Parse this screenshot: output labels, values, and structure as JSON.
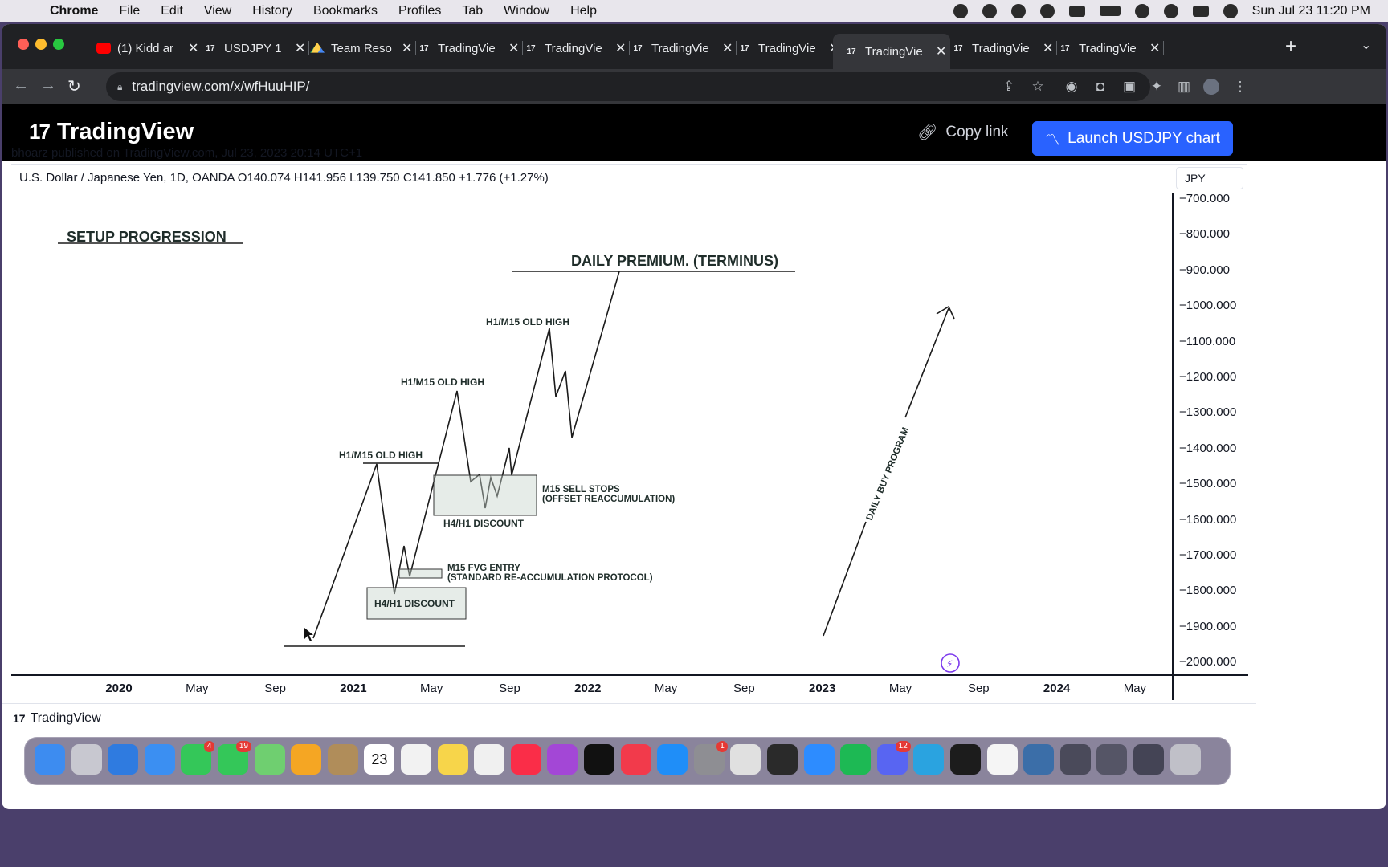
{
  "menubar": {
    "app": "Chrome",
    "items": [
      "File",
      "Edit",
      "View",
      "History",
      "Bookmarks",
      "Profiles",
      "Tab",
      "Window",
      "Help"
    ],
    "clock": "Sun Jul 23  11:20 PM"
  },
  "tabs": [
    {
      "label": "(1) Kidd ar",
      "icon": "youtube-icon"
    },
    {
      "label": "USDJPY 1",
      "icon": "tradingview-icon"
    },
    {
      "label": "Team Reso",
      "icon": "drive-icon"
    },
    {
      "label": "TradingVie",
      "icon": "tradingview-icon"
    },
    {
      "label": "TradingVie",
      "icon": "tradingview-icon"
    },
    {
      "label": "TradingVie",
      "icon": "tradingview-icon"
    },
    {
      "label": "TradingVie",
      "icon": "tradingview-icon"
    },
    {
      "label": "TradingVie",
      "icon": "tradingview-icon",
      "active": true
    },
    {
      "label": "TradingVie",
      "icon": "tradingview-icon"
    },
    {
      "label": "TradingVie",
      "icon": "tradingview-icon"
    }
  ],
  "address": {
    "url": "tradingview.com/x/wfHuuHIP/"
  },
  "tvheader": {
    "logo": "TradingView",
    "copy_link": "Copy link",
    "launch": "Launch USDJPY chart"
  },
  "published": "bhoarz published on TradingView.com, Jul 23, 2023 20:14 UTC+1",
  "symbol": {
    "line": "U.S. Dollar / Japanese Yen, 1D, OANDA  O140.074  H141.956  L139.750  C141.850  +1.776 (+1.27%)",
    "currency": "JPY"
  },
  "chart_data": {
    "type": "drawing",
    "y_ticks": [
      "−700.000",
      "−800.000",
      "−900.000",
      "−1000.000",
      "−1100.000",
      "−1200.000",
      "−1300.000",
      "−1400.000",
      "−1500.000",
      "−1600.000",
      "−1700.000",
      "−1800.000",
      "−1900.000",
      "−2000.000"
    ],
    "x_ticks": [
      {
        "label": "2020",
        "year": true
      },
      {
        "label": "May"
      },
      {
        "label": "Sep"
      },
      {
        "label": "2021",
        "year": true
      },
      {
        "label": "May"
      },
      {
        "label": "Sep"
      },
      {
        "label": "2022",
        "year": true
      },
      {
        "label": "May"
      },
      {
        "label": "Sep"
      },
      {
        "label": "2023",
        "year": true
      },
      {
        "label": "May"
      },
      {
        "label": "Sep"
      },
      {
        "label": "2024",
        "year": true
      },
      {
        "label": "May"
      }
    ],
    "annotations": {
      "setup": "SETUP PROGRESSION",
      "premium": "DAILY PREMIUM. (TERMINUS)",
      "old_high_1": "H1/M15 OLD HIGH",
      "old_high_2": "H1/M15 OLD HIGH",
      "old_high_3": "H1/M15 OLD HIGH",
      "sell_stops_1": "M15 SELL STOPS",
      "sell_stops_2": "(OFFSET REACCUMULATION)",
      "discount_1": "H4/H1 DISCOUNT",
      "discount_2": "H4/H1 DISCOUNT",
      "fvg_1": "M15 FVG ENTRY",
      "fvg_2": "(STANDARD RE-ACCUMULATION PROTOCOL)",
      "program": "DAILY BUY PROGRAM"
    }
  },
  "footer": {
    "logo": "TradingView"
  },
  "dock": {
    "apps": [
      {
        "name": "finder-icon",
        "color": "#3d8cf0"
      },
      {
        "name": "launchpad-icon",
        "color": "#c8c8d0"
      },
      {
        "name": "safari-icon",
        "color": "#2f7be0"
      },
      {
        "name": "mail-icon",
        "color": "#3b8ff2"
      },
      {
        "name": "facetime-icon",
        "color": "#34c759",
        "badge": "4"
      },
      {
        "name": "messages-icon",
        "color": "#34c759",
        "badge": "19"
      },
      {
        "name": "maps-icon",
        "color": "#6fcf70"
      },
      {
        "name": "photos-icon",
        "color": "#f5a623"
      },
      {
        "name": "contacts-icon",
        "color": "#b08d5a"
      },
      {
        "name": "calendar-icon",
        "color": "#ffffff",
        "text": "23"
      },
      {
        "name": "reminders-icon",
        "color": "#f2f2f2"
      },
      {
        "name": "notes-icon",
        "color": "#f7d54a"
      },
      {
        "name": "freeform-icon",
        "color": "#f0f0f0"
      },
      {
        "name": "music-icon",
        "color": "#fa2d48"
      },
      {
        "name": "podcasts-icon",
        "color": "#a347d6"
      },
      {
        "name": "appletv-icon",
        "color": "#111111"
      },
      {
        "name": "news-icon",
        "color": "#f23a4b"
      },
      {
        "name": "appstore-icon",
        "color": "#1f8ef8"
      },
      {
        "name": "settings-icon",
        "color": "#8e8e93",
        "badge": "1"
      },
      {
        "name": "chrome-icon",
        "color": "#e0e0e0"
      },
      {
        "name": "obs-icon",
        "color": "#2a2a2a"
      },
      {
        "name": "zoom-icon",
        "color": "#2d8cff"
      },
      {
        "name": "spotify-icon",
        "color": "#1db954"
      },
      {
        "name": "discord-icon",
        "color": "#5865f2",
        "badge": "12"
      },
      {
        "name": "telegram-icon",
        "color": "#2aa3e0"
      },
      {
        "name": "activity-monitor-icon",
        "color": "#1c1c1c"
      },
      {
        "name": "textedit-icon",
        "color": "#f5f5f5"
      },
      {
        "name": "quicktime-icon",
        "color": "#3b6ea8"
      },
      {
        "name": "folder-icon",
        "color": "#4a4a5a"
      },
      {
        "name": "folder-icon-2",
        "color": "#555566"
      },
      {
        "name": "folder-icon-3",
        "color": "#444455"
      },
      {
        "name": "trash-icon",
        "color": "#c0c0c8"
      }
    ]
  }
}
